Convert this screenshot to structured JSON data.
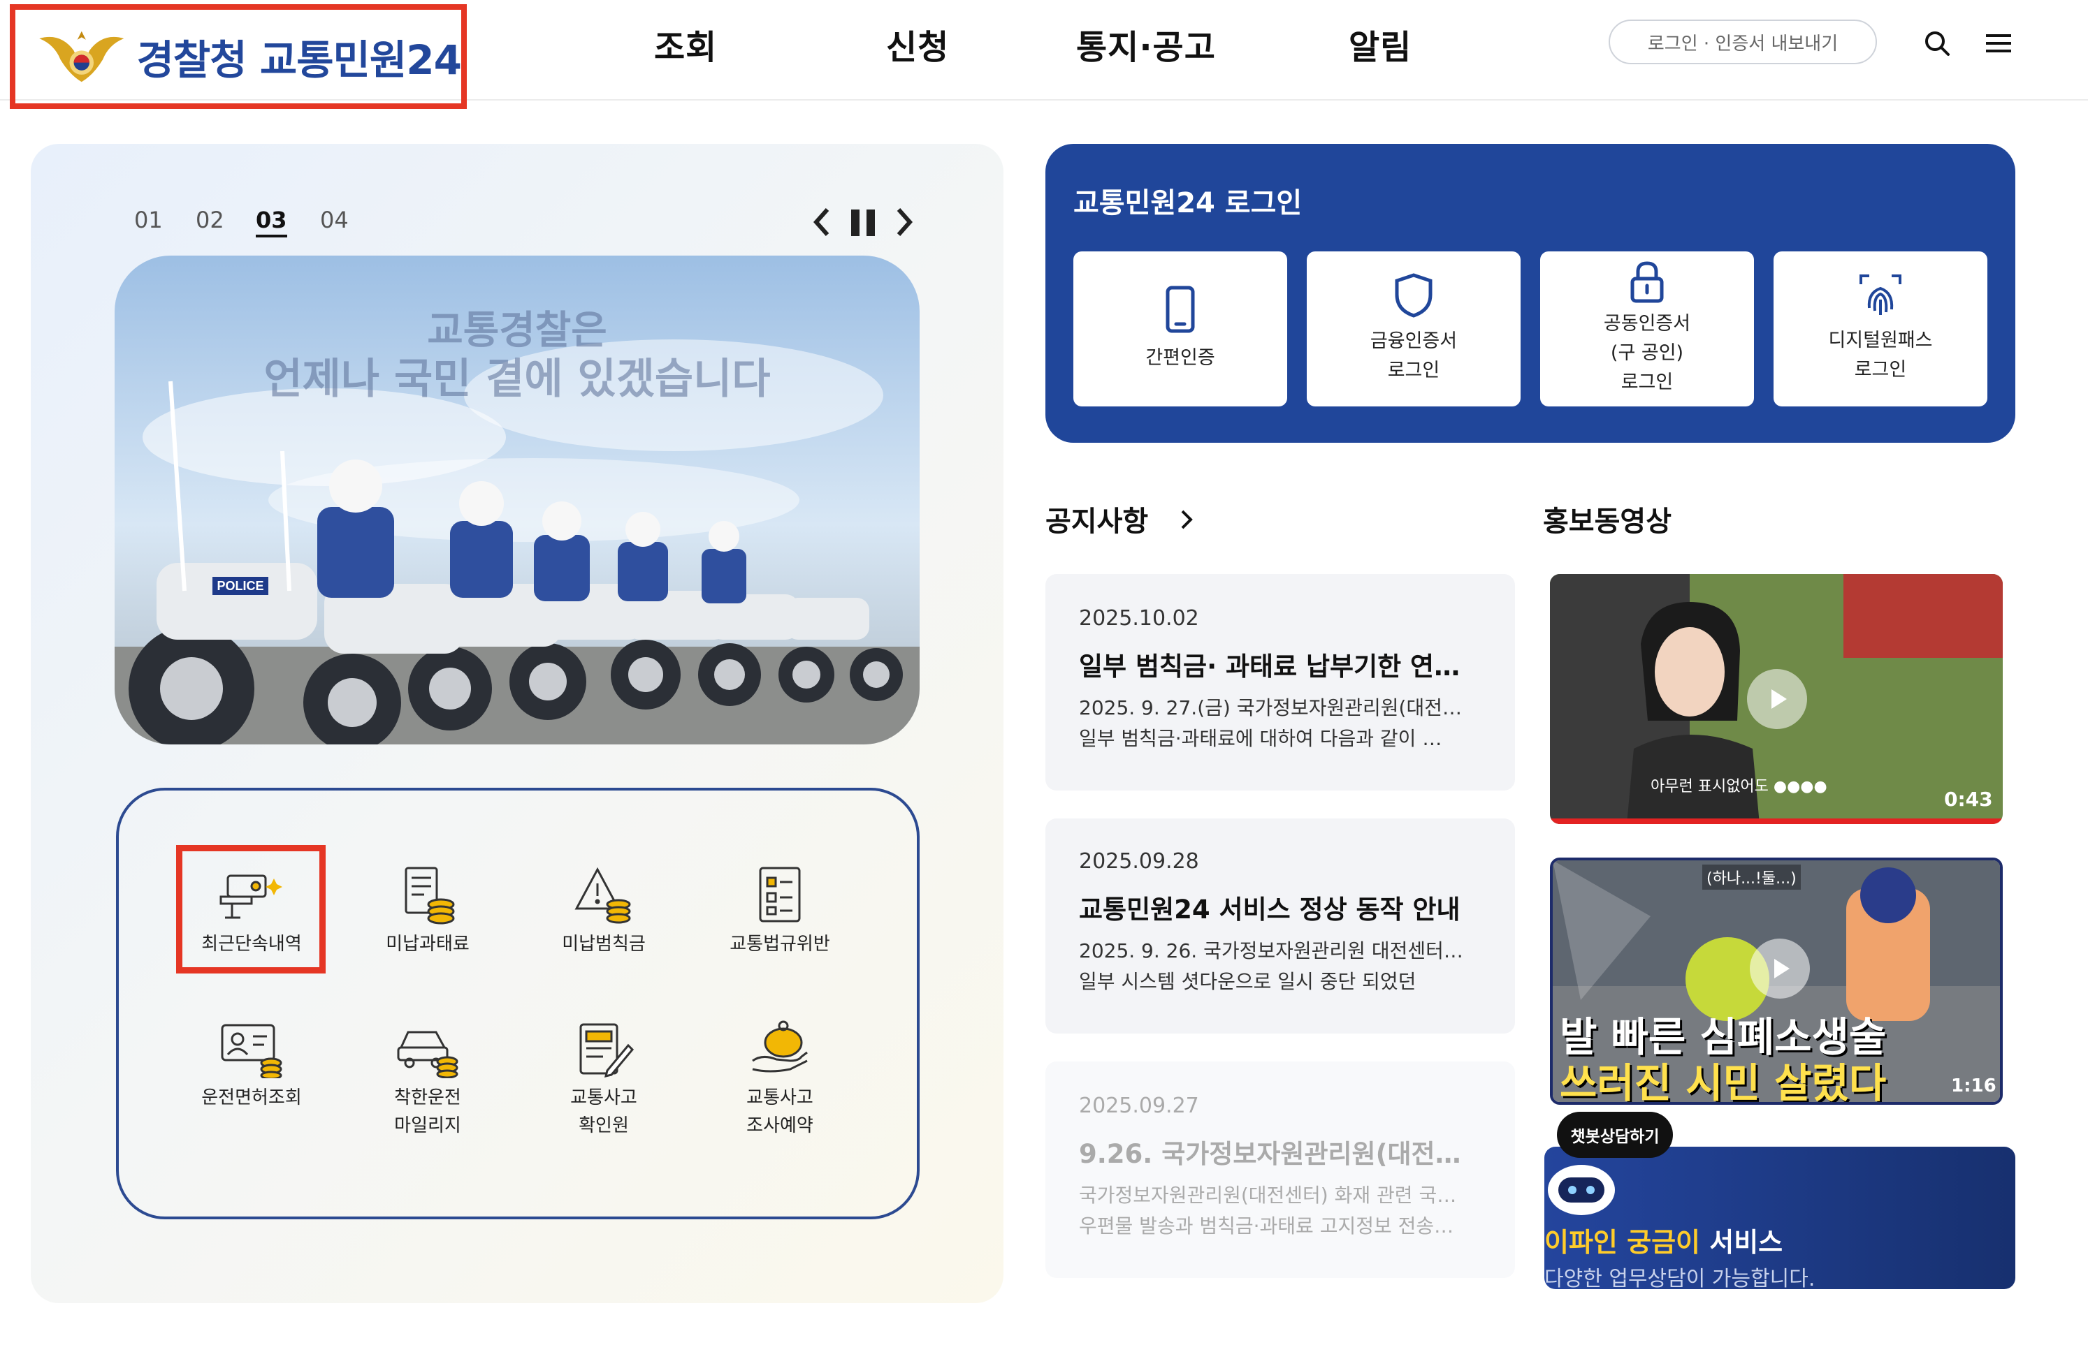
{
  "header": {
    "logo_text": "경찰청 교통민원24",
    "nav": [
      "조회",
      "신청",
      "통지·공고",
      "알림"
    ],
    "login_link": "로그인 · 인증서 내보내기",
    "icons": [
      "search-icon",
      "menu-icon"
    ]
  },
  "slider": {
    "tabs": [
      "01",
      "02",
      "03",
      "04"
    ],
    "active_tab": "03",
    "banner_line1": "교통경찰은",
    "banner_line2": "언제나 국민 곁에 있겠습니다",
    "police_text": "POLICE"
  },
  "quick_menu": {
    "items": [
      {
        "label": "최근단속내역",
        "icon": "camera-icon"
      },
      {
        "label": "미납과태료",
        "icon": "bill-coins-icon"
      },
      {
        "label": "미납범칙금",
        "icon": "warning-coins-icon"
      },
      {
        "label": "교통법규위반",
        "icon": "checklist-icon"
      },
      {
        "label": "운전면허조회",
        "icon": "license-icon"
      },
      {
        "label": "착한운전\n마일리지",
        "icon": "car-coins-icon"
      },
      {
        "label": "교통사고\n확인원",
        "icon": "document-pen-icon"
      },
      {
        "label": "교통사고\n조사예약",
        "icon": "piggy-bank-icon"
      }
    ]
  },
  "login": {
    "title": "교통민원24 로그인",
    "options": [
      {
        "label": "간편인증",
        "icon": "phone-icon"
      },
      {
        "label": "금융인증서\n로그인",
        "icon": "shield-icon"
      },
      {
        "label": "공동인증서\n(구 공인)\n로그인",
        "icon": "lock-icon"
      },
      {
        "label": "디지털원패스\n로그인",
        "icon": "fingerprint-icon"
      }
    ]
  },
  "notices": {
    "title": "공지사항",
    "items": [
      {
        "date": "2025.10.02",
        "title": "일부 범칙금· 과태료 납부기한 연…",
        "line1": "2025. 9. 27.(금) 국가정보자원관리원(대전…",
        "line2": "일부 범칙금·과태료에 대하여 다음과 같이 …"
      },
      {
        "date": "2025.09.28",
        "title": "교통민원24 서비스 정상 동작 안내",
        "line1": "2025. 9. 26. 국가정보자원관리원 대전센터…",
        "line2": "일부 시스템 셧다운으로 일시 중단 되었던"
      },
      {
        "date": "2025.09.27",
        "title": "9.26. 국가정보자원관리원(대전센…",
        "line1": "국가정보자원관리원(대전센터) 화재 관련 국…",
        "line2": "우편물 발송과 범칙금·과태료 고지정보 전송…"
      }
    ]
  },
  "videos": {
    "title": "홍보동영상",
    "items": [
      {
        "duration": "0:43",
        "caption": "아무런 표시없어도 ●●●●"
      },
      {
        "duration": "1:16",
        "caption_top": "(하나...!둘...)",
        "line1": "발 빠른 심폐소생술",
        "line2": "쓰러진 시민 살렸다"
      }
    ]
  },
  "chatbot": {
    "bubble": "챗봇상담하기",
    "title_highlight": "이파인 궁금이",
    "title_rest": " 서비스",
    "subtitle": "다양한 업무상담이 가능합니다."
  },
  "colors": {
    "brand_blue": "#20469a",
    "highlight_red": "#e53624",
    "logo_blue": "#22479b",
    "chat_yellow": "#ffcc2a"
  }
}
